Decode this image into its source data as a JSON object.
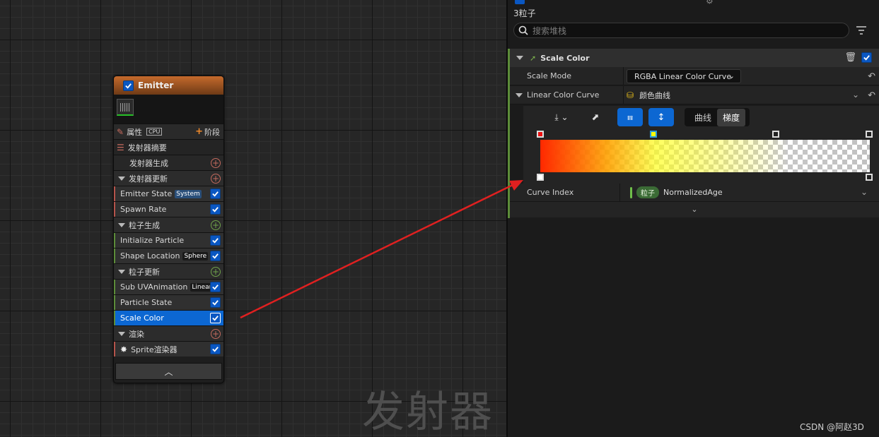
{
  "graph": {
    "watermark": "发射器",
    "node": {
      "title": "Emitter",
      "properties_label": "属性",
      "cpu_badge": "CPU",
      "add_stage_label": "阶段",
      "summary_label": "发射器摘要",
      "emitter_spawn_label": "发射器生成",
      "emitter_update_label": "发射器更新",
      "emitter_state_label": "Emitter State",
      "emitter_state_tag": "System",
      "spawn_rate_label": "Spawn Rate",
      "particle_spawn_label": "粒子生成",
      "initialize_particle_label": "Initialize Particle",
      "shape_location_label": "Shape Location",
      "shape_location_tag": "Sphere",
      "particle_update_label": "粒子更新",
      "sub_uv_label": "Sub UVAnimation",
      "sub_uv_tag": "Linear",
      "particle_state_label": "Particle State",
      "scale_color_label": "Scale Color",
      "render_label": "渲染",
      "sprite_renderer_label": "Sprite渲染器"
    }
  },
  "details": {
    "particle_count": "3粒子",
    "search_placeholder": "搜索堆栈",
    "module_title": "Scale Color",
    "scale_mode_label": "Scale Mode",
    "scale_mode_value": "RGBA Linear Color Curve",
    "linear_curve_label": "Linear Color Curve",
    "linear_curve_asset": "颜色曲线",
    "tab_curve": "曲线",
    "tab_gradient": "梯度",
    "curve_index_label": "Curve Index",
    "curve_index_pill": "粒子",
    "curve_index_value": "NormalizedAge"
  },
  "watermark": "CSDN @阿赵3D",
  "colors": {
    "accent_blue": "#0c67d2",
    "module_green": "#5c8c39",
    "arrow_red": "#e02020",
    "emitter_header": "#c56a2c"
  }
}
